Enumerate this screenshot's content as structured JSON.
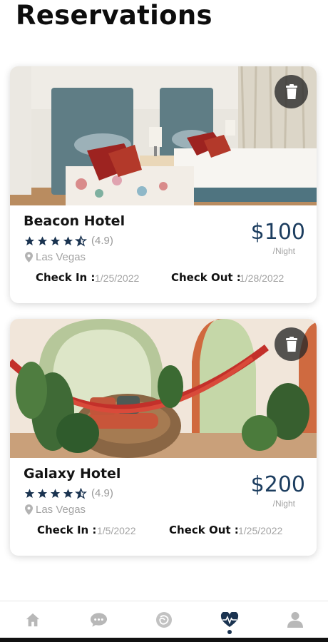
{
  "page": {
    "title": "Reservations"
  },
  "reservations": [
    {
      "name": "Beacon Hotel",
      "rating": "(4.9)",
      "stars": 4.5,
      "location": "Las Vegas",
      "price": "$100",
      "price_unit": "/Night",
      "check_in_label": "Check In :",
      "check_in": "1/25/2022",
      "check_out_label": "Check Out :",
      "check_out": "1/28/2022",
      "photo_icon": "hotel-bedroom-photo"
    },
    {
      "name": "Galaxy Hotel",
      "rating": "(4.9)",
      "stars": 4.5,
      "location": "Las Vegas",
      "price": "$200",
      "price_unit": "/Night",
      "check_in_label": "Check In :",
      "check_in": "1/5/2022",
      "check_out_label": "Check Out :",
      "check_out": "1/25/2022",
      "photo_icon": "hammock-patio-photo"
    }
  ],
  "nav": {
    "items": [
      "home-icon",
      "chat-icon",
      "explore-icon",
      "health-heart-icon",
      "profile-icon"
    ],
    "active": "health-heart-icon"
  },
  "colors": {
    "accent": "#1c3d5f",
    "muted": "#a3a3a3",
    "stars": "#1a3350"
  }
}
